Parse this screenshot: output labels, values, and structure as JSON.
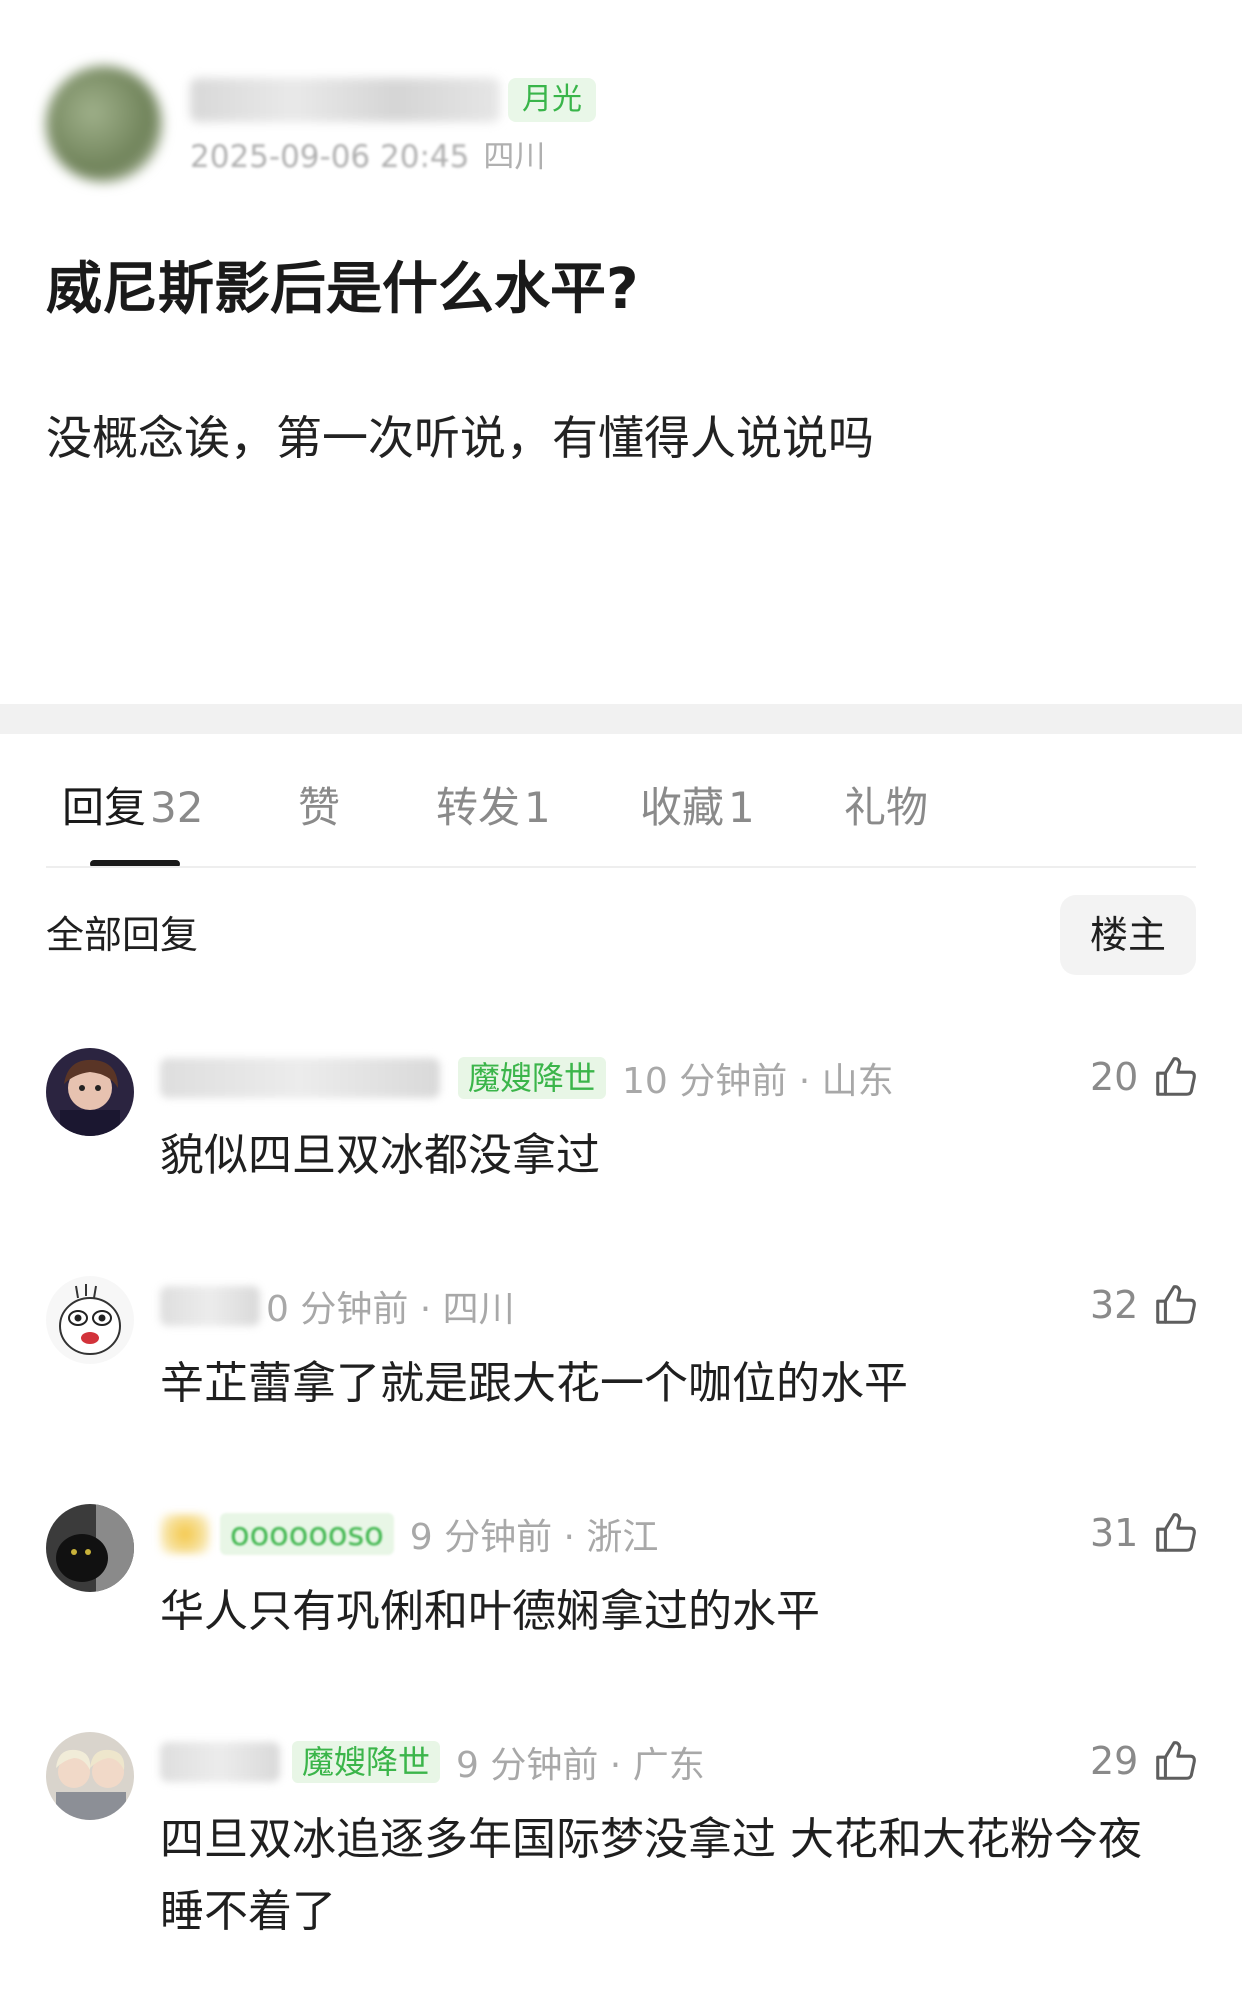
{
  "post": {
    "author_badge": "月光",
    "timestamp": "2025-09-06 20:45",
    "location": "四川",
    "title": "威尼斯影后是什么水平?",
    "body": "没概念诶，第一次听说，有懂得人说说吗"
  },
  "tabs": [
    {
      "label": "回复",
      "count": "32",
      "active": true
    },
    {
      "label": "赞",
      "count": "",
      "active": false
    },
    {
      "label": "转发",
      "count": "1",
      "active": false
    },
    {
      "label": "收藏",
      "count": "1",
      "active": false
    },
    {
      "label": "礼物",
      "count": "",
      "active": false
    }
  ],
  "replies_header": {
    "title": "全部回复",
    "op_filter": "楼主"
  },
  "comments": [
    {
      "badge": "魔嫂降世",
      "meta": "10 分钟前 · 山东",
      "text": "貌似四旦双冰都没拿过",
      "likes": "20"
    },
    {
      "badge": "",
      "meta": "0 分钟前 · 四川",
      "text": "辛芷蕾拿了就是跟大花一个咖位的水平",
      "likes": "32"
    },
    {
      "badge": "ooooooso",
      "meta": "9 分钟前 · 浙江",
      "text": "华人只有巩俐和叶德娴拿过的水平",
      "likes": "31"
    },
    {
      "badge": "魔嫂降世",
      "meta": "9 分钟前 · 广东",
      "text": "四旦双冰追逐多年国际梦没拿过 大花和大花粉今夜睡不着了",
      "likes": "29"
    }
  ],
  "colors": {
    "badge_green": "#3bb54a",
    "badge_bg": "#e8f6e6",
    "divider": "#f1f1f1",
    "muted_text": "#a8a8a8"
  },
  "icons": {
    "like": "thumbs-up-icon"
  }
}
